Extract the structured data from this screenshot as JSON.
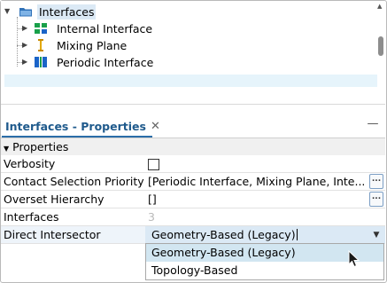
{
  "tree": {
    "root": {
      "label": "Interfaces",
      "icon": "folder-icon"
    },
    "children": [
      {
        "label": "Internal Interface",
        "icon": "internal-interface-icon"
      },
      {
        "label": "Mixing Plane",
        "icon": "mixing-plane-icon"
      },
      {
        "label": "Periodic Interface",
        "icon": "periodic-interface-icon"
      }
    ]
  },
  "panel": {
    "tab_title": "Interfaces - Properties",
    "close_glyph": "✕",
    "minimize_glyph": "—"
  },
  "properties": {
    "group_label": "Properties",
    "rows": [
      {
        "name": "Verbosity",
        "value": "",
        "type": "checkbox"
      },
      {
        "name": "Contact Selection Priority",
        "value": "[Periodic Interface, Mixing Plane, Inte...",
        "type": "ellipsis"
      },
      {
        "name": "Overset Hierarchy",
        "value": "[]",
        "type": "ellipsis"
      },
      {
        "name": "Interfaces",
        "value": "3",
        "type": "readonly"
      },
      {
        "name": "Direct Intersector",
        "value": "Geometry-Based (Legacy)",
        "type": "combo"
      }
    ],
    "ellipsis_label": "..."
  },
  "dropdown": {
    "options": [
      "Geometry-Based (Legacy)",
      "Topology-Based"
    ],
    "hovered_index": 0
  },
  "colors": {
    "accent": "#2b6da8",
    "selection": "#dbe9f5",
    "hover": "#d2e6f1"
  }
}
